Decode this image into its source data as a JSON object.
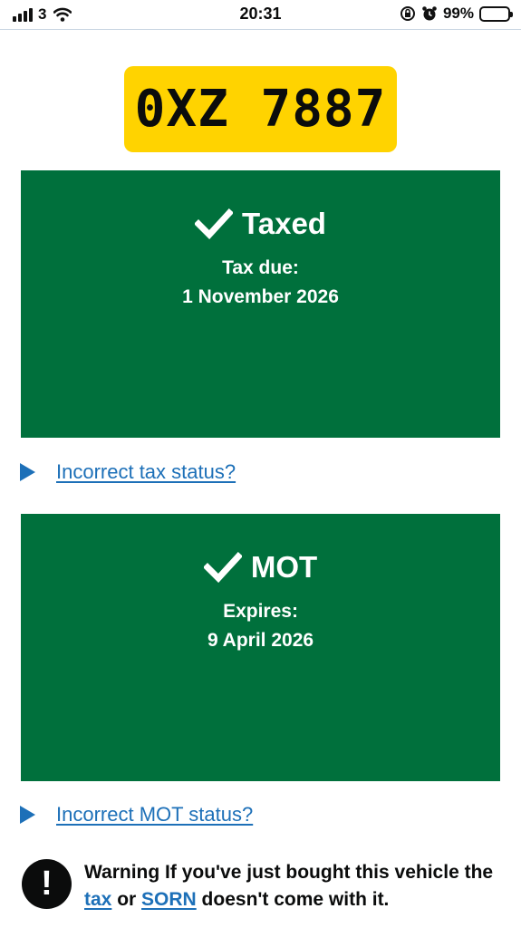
{
  "status_bar": {
    "carrier": "3",
    "time": "20:31",
    "battery_percent": "99%",
    "battery_level": 0.99,
    "icons": [
      "signal-bars-icon",
      "wifi-icon",
      "orientation-lock-icon",
      "alarm-icon",
      "battery-icon"
    ]
  },
  "vehicle": {
    "registration": "0XZ 7887"
  },
  "tax_panel": {
    "title": "Taxed",
    "label": "Tax due:",
    "date": "1 November 2026",
    "icon": "check-icon"
  },
  "tax_link": {
    "text": "Incorrect tax status?",
    "icon": "triangle-right-icon"
  },
  "mot_panel": {
    "title": "MOT",
    "label": "Expires:",
    "date": "9 April 2026",
    "icon": "check-icon"
  },
  "mot_link": {
    "text": "Incorrect MOT status?",
    "icon": "triangle-right-icon"
  },
  "warning": {
    "icon_glyph": "!",
    "text_before": "Warning If you've just bought this vehicle the ",
    "link_tax": "tax",
    "text_middle": " or ",
    "link_sorn": "SORN",
    "text_after": " doesn't come with it."
  },
  "colors": {
    "plate": "#ffd300",
    "panel_green": "#00703c",
    "link_blue": "#1d70b8",
    "text": "#0b0c0c"
  }
}
